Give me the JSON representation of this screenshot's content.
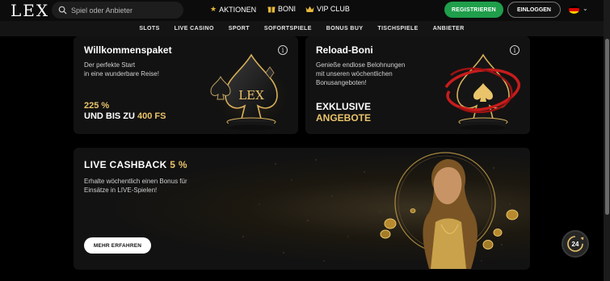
{
  "brand": {
    "logo_text": "LEX"
  },
  "search": {
    "placeholder": "Spiel oder Anbieter"
  },
  "topnav": {
    "aktionen": "AKTIONEN",
    "boni": "BONI",
    "vip": "VIP CLUB"
  },
  "auth": {
    "register": "REGISTRIEREN",
    "login": "EINLOGGEN"
  },
  "subnav": [
    "SLOTS",
    "LIVE CASINO",
    "SPORT",
    "SOFORTSPIELE",
    "BONUS BUY",
    "TISCHSPIELE",
    "ANBIETER"
  ],
  "cards": {
    "welcome": {
      "title": "Willkommenspaket",
      "desc_line1": "Der perfekte Start",
      "desc_line2": "in eine wunderbare Reise!",
      "promo_line1": "225 %",
      "promo_line2_prefix": "UND BIS ZU",
      "promo_line2_highlight": "400 FS",
      "art_text": "LEX"
    },
    "reload": {
      "title": "Reload-Boni",
      "desc_line1": "Genieße endlose Belohnungen",
      "desc_line2": "mit unseren wöchentlichen",
      "desc_line3": "Bonusangeboten!",
      "promo_line1": "EXKLUSIVE",
      "promo_line2": "ANGEBOTE"
    }
  },
  "banner": {
    "title_prefix": "LIVE CASHBACK",
    "title_highlight": "5 %",
    "desc_line1": "Erhalte wöchentlich einen Bonus für",
    "desc_line2": "Einsätze in LIVE-Spielen!",
    "button": "MEHR ERFAHREN"
  },
  "chat": {
    "badge": "24"
  },
  "colors": {
    "accent_gold": "#e9c46a",
    "register_green": "#1f9e4b",
    "background": "#000000",
    "card_bg": "#121212"
  }
}
